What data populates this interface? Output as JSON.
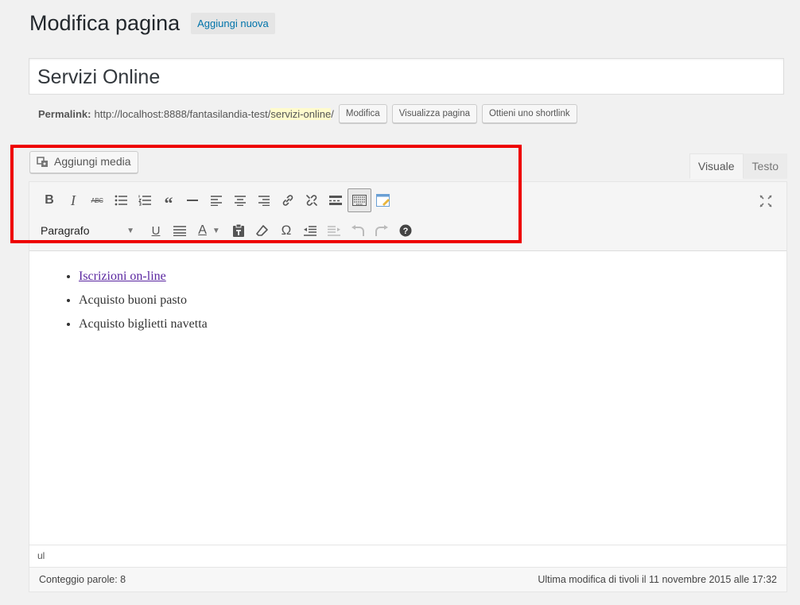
{
  "header": {
    "title": "Modifica pagina",
    "add_new": "Aggiungi nuova"
  },
  "post_title": "Servizi Online",
  "permalink": {
    "label": "Permalink:",
    "base": "http://localhost:8888/fantasilandia-test/",
    "slug": "servizi-online",
    "trail": "/",
    "buttons": {
      "edit": "Modifica",
      "view": "Visualizza pagina",
      "shortlink": "Ottieni uno shortlink"
    }
  },
  "media_button": "Aggiungi media",
  "tabs": {
    "visual": "Visuale",
    "text": "Testo"
  },
  "toolbar": {
    "format_select": "Paragrafo",
    "icons_row1": [
      "bold-icon",
      "italic-icon",
      "strikethrough-icon",
      "bullet-list-icon",
      "numbered-list-icon",
      "blockquote-icon",
      "horizontal-rule-icon",
      "align-left-icon",
      "align-center-icon",
      "align-right-icon",
      "link-icon",
      "unlink-icon",
      "read-more-icon",
      "toolbar-toggle-icon",
      "distraction-free-icon"
    ],
    "icons_row2": [
      "underline-icon",
      "justify-icon",
      "text-color-icon",
      "paste-as-text-icon",
      "clear-formatting-icon",
      "special-character-icon",
      "outdent-icon",
      "indent-icon",
      "undo-icon",
      "redo-icon",
      "help-icon"
    ]
  },
  "content": {
    "items": [
      {
        "text": "Iscrizioni on-line",
        "link": true
      },
      {
        "text": "Acquisto buoni pasto",
        "link": false
      },
      {
        "text": "Acquisto biglietti navetta",
        "link": false
      }
    ]
  },
  "path_bar": "ul",
  "status": {
    "word_count": "Conteggio parole: 8",
    "last_edit": "Ultima modifica di tivoli il 11 novembre 2015 alle 17:32"
  },
  "colors": {
    "link": "#0073aa",
    "highlight_border": "#e00000",
    "slug_bg": "#fffbcc"
  }
}
